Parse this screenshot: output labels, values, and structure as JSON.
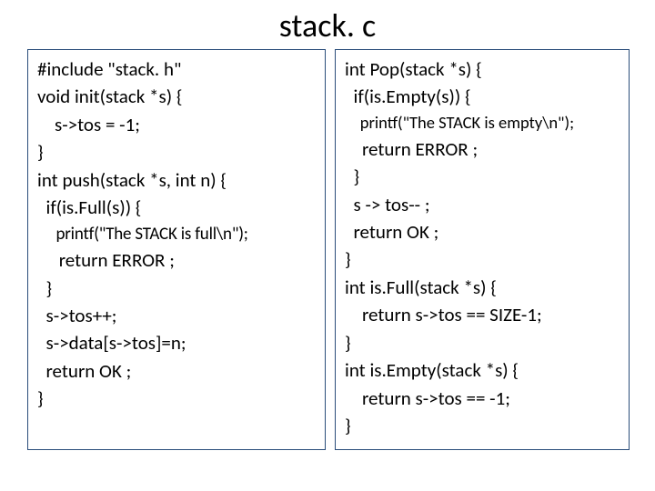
{
  "title": "stack. c",
  "left": {
    "lines": [
      "#include \"stack. h\"",
      "void init(stack *s) {",
      "    s->tos = -1;",
      "}",
      "int push(stack *s, int n) {",
      "  if(is.Full(s)) {",
      "     printf(\"The STACK is full\\n\");",
      "     return ERROR ;",
      "  }",
      "  s->tos++;",
      "  s->data[s->tos]=n;",
      "  return OK ;",
      "}"
    ]
  },
  "right": {
    "lines": [
      "int Pop(stack *s) {",
      "  if(is.Empty(s)) {",
      "    printf(\"The STACK is empty\\n\");",
      "    return ERROR ;",
      "  }",
      "  s -> tos-- ;",
      "  return OK ;",
      "}",
      "int is.Full(stack *s) {",
      "    return s->tos == SIZE-1;",
      "}",
      "int is.Empty(stack *s) {",
      "    return s->tos == -1;",
      "}"
    ]
  }
}
